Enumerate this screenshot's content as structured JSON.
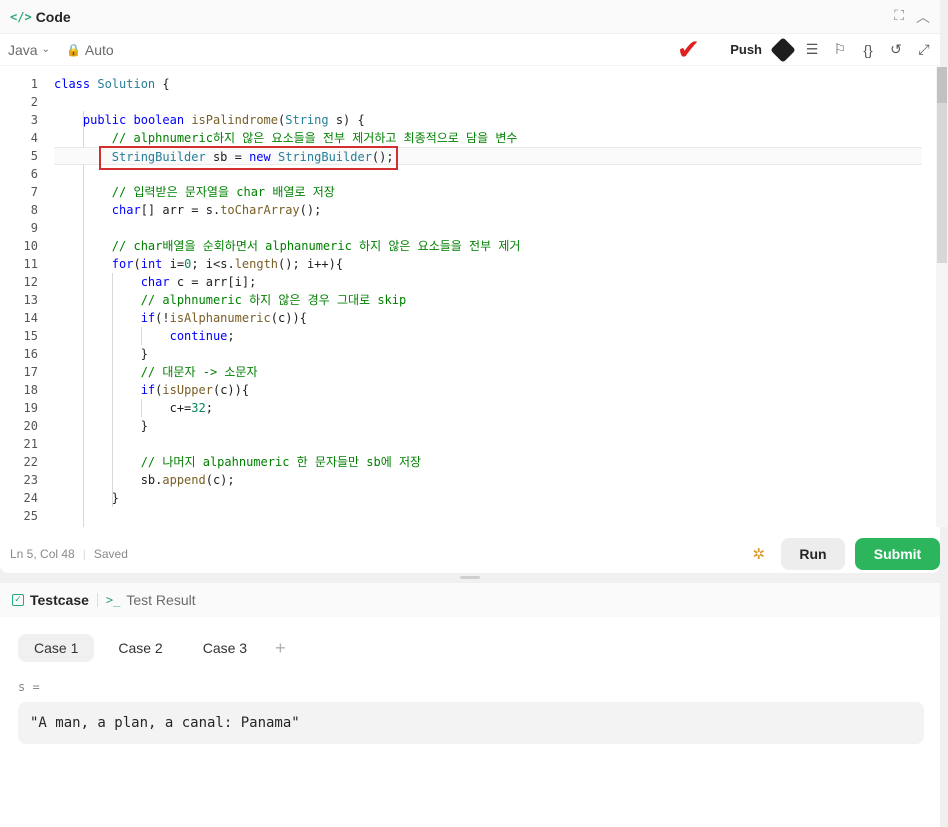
{
  "header": {
    "icon": "</>",
    "title": "Code"
  },
  "toolbar": {
    "language": "Java",
    "mode": "Auto",
    "push_label": "Push"
  },
  "editor": {
    "line_numbers": [
      "1",
      "2",
      "3",
      "4",
      "5",
      "6",
      "7",
      "8",
      "9",
      "10",
      "11",
      "12",
      "13",
      "14",
      "15",
      "16",
      "17",
      "18",
      "19",
      "20",
      "21",
      "22",
      "23",
      "24",
      "25"
    ]
  },
  "status": {
    "position": "Ln 5, Col 48",
    "saved": "Saved"
  },
  "actions": {
    "run": "Run",
    "submit": "Submit"
  },
  "testpanel": {
    "tab_testcase": "Testcase",
    "tab_result": "Test Result",
    "cases": [
      "Case 1",
      "Case 2",
      "Case 3"
    ],
    "var_label": "s =",
    "var_value": "\"A man, a plan, a canal: Panama\""
  },
  "colors": {
    "accent": "#2db55d",
    "highlight": "#d32f2f",
    "check": "#e02020"
  },
  "icons": [
    "code-icon",
    "fullscreen-icon",
    "collapse-icon",
    "chevron-down-icon",
    "lock-icon",
    "checkmark-icon",
    "git-icon",
    "format-icon",
    "bookmark-icon",
    "braces-icon",
    "undo-icon",
    "expand-icon",
    "debug-icon",
    "checkbox-icon",
    "terminal-icon",
    "plus-icon"
  ]
}
